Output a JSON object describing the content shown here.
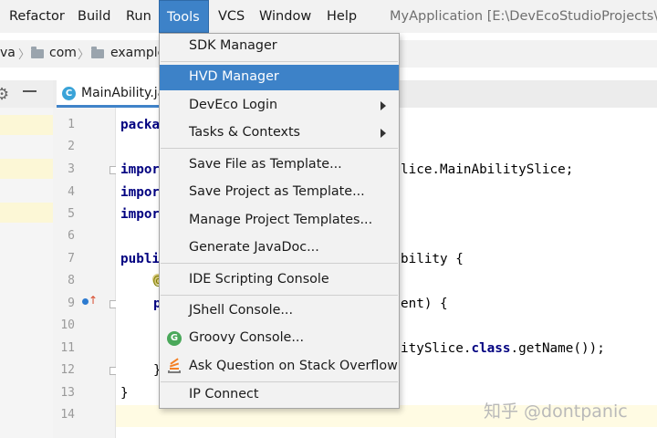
{
  "menubar": {
    "items": [
      "Refactor",
      "Build",
      "Run",
      "Tools",
      "VCS",
      "Window",
      "Help"
    ],
    "active": "Tools",
    "window_title": "MyApplication [E:\\DevEcoStudioProjects\\MyA"
  },
  "breadcrumb": [
    "va",
    "com",
    "example"
  ],
  "editor": {
    "tab_label": "MainAbility.ja",
    "line_numbers": [
      "1",
      "2",
      "3",
      "4",
      "5",
      "6",
      "7",
      "8",
      "9",
      "10",
      "11",
      "12",
      "13",
      "14"
    ],
    "lines": {
      "l1": "packa",
      "l3a": "impor",
      "l3b": "lice.MainAbilitySlice;",
      "l4": "impor",
      "l5": "impor",
      "l7a": "publi",
      "l7b": "bility {",
      "l8": "@",
      "l9a": "p",
      "l9b": "ent) {",
      "l11a": "itySlice.",
      "l11kw": "class",
      "l11b": ".getName());",
      "l12": "}",
      "l13": "}"
    }
  },
  "tools_menu": {
    "items": [
      {
        "label": "SDK Manager"
      },
      {
        "label": "HVD Manager",
        "selected": true
      },
      {
        "label": "DevEco Login",
        "submenu": true
      },
      {
        "label": "Tasks & Contexts",
        "submenu": true
      },
      {
        "label": "Save File as Template..."
      },
      {
        "label": "Save Project as Template..."
      },
      {
        "label": "Manage Project Templates..."
      },
      {
        "label": "Generate JavaDoc..."
      },
      {
        "label": "IDE Scripting Console"
      },
      {
        "label": "JShell Console..."
      },
      {
        "label": "Groovy Console...",
        "icon": "groovy-icon"
      },
      {
        "label": "Ask Question on Stack Overflow",
        "icon": "stackoverflow-icon"
      },
      {
        "label": "IP Connect"
      }
    ]
  },
  "icons": {
    "groovy_letter": "G",
    "class_letter": "C"
  },
  "watermark": "知乎 @dontpanic",
  "colors": {
    "selection": "#3d82c8",
    "current_line": "#fffbe3",
    "keyword": "#000080"
  }
}
